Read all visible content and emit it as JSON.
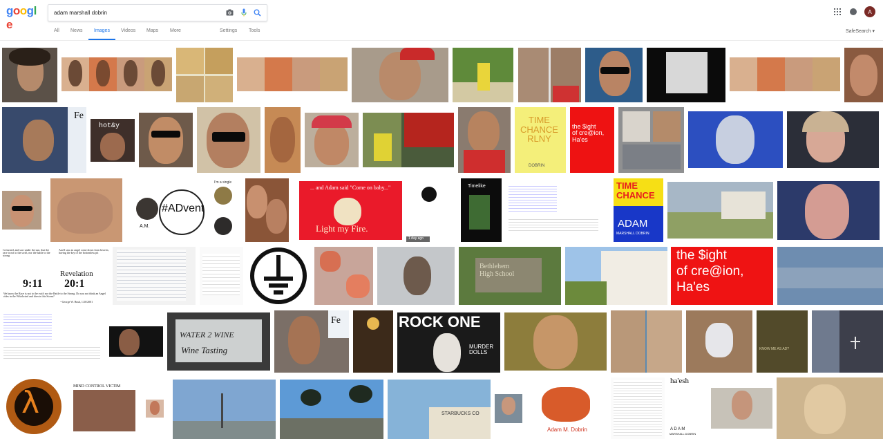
{
  "header": {
    "logo": "google",
    "logo_letters": [
      "g",
      "o",
      "o",
      "g",
      "l",
      "e"
    ],
    "logo_colors": [
      "#4285f4",
      "#ea4335",
      "#fbbc05",
      "#4285f4",
      "#34a853",
      "#ea4335"
    ],
    "search_value": "adam marshall dobrin",
    "avatar_letter": "A",
    "icons": [
      "camera-icon",
      "microphone-icon",
      "search-icon",
      "apps-icon",
      "notifications-icon"
    ]
  },
  "tabs": [
    "All",
    "News",
    "Images",
    "Videos",
    "Maps",
    "More",
    "Settings",
    "Tools"
  ],
  "active_tab": "Images",
  "safesearch": "SafeSearch",
  "colors": {
    "accent": "#1a73e8",
    "avatar": "#7a2a26"
  },
  "thumb_text": {
    "hotandy": "hot&y",
    "fe": "Fe",
    "time_chance": "TIME\nCHANCE\nRLNY",
    "dobrin_small": "DOBRIN",
    "sight_red": "the $ight\nof cre@ion,\nHa'es",
    "timelike": "Timelike",
    "timelike_year": "1984",
    "time_blue_1": "TIME\nCHANCE",
    "time_blue_2": "ADAM",
    "time_blue_3": "MARSHALL DOBRIN",
    "advent_mid": "#ADvent",
    "advent_top": "I'm a single",
    "advent_am": "A.M.",
    "light_fire_1": "... and Adam said \"Come on baby...\"",
    "light_fire_2": "Light my Fire.",
    "day_ago": "1 day ago",
    "revelation_title": "Revelation",
    "revelation_911": "9:11",
    "revelation_201": "20:1",
    "bethlehem": "Bethlehem\nHigh School",
    "water_wine": "WATER 2 WINE",
    "water_wine_sub": "Wine Tasting",
    "rock_one": "ROCK ONE",
    "murder_dolls": "MURDER\nDOLLS",
    "know_me": "KNOW ME AS AD?",
    "mind_control": "MIND CONTROL VICTIM",
    "starbucks": "STARBUCKS CO",
    "adam_m_dobrin": "Adam M. Dobrin",
    "ha_esh": "ha'esh",
    "adam_bottom": "A D A M",
    "marshall_bottom": "MARSHALL DOBRIN",
    "revelation_quote": "I returned, and saw under the sun, that the race is not to the swift, nor the battle to the strong",
    "revelation_quote2": "And I saw an angel come down from heaven, having the key of the bottomless pit",
    "bush_quote": "We know the Race is not to the swift nor the Battle to the Strong. Do you not think an Angel rides in the Whirlwind and directs this Storm?",
    "bush_sig": "--George W. Bush, 1/20/2001"
  }
}
